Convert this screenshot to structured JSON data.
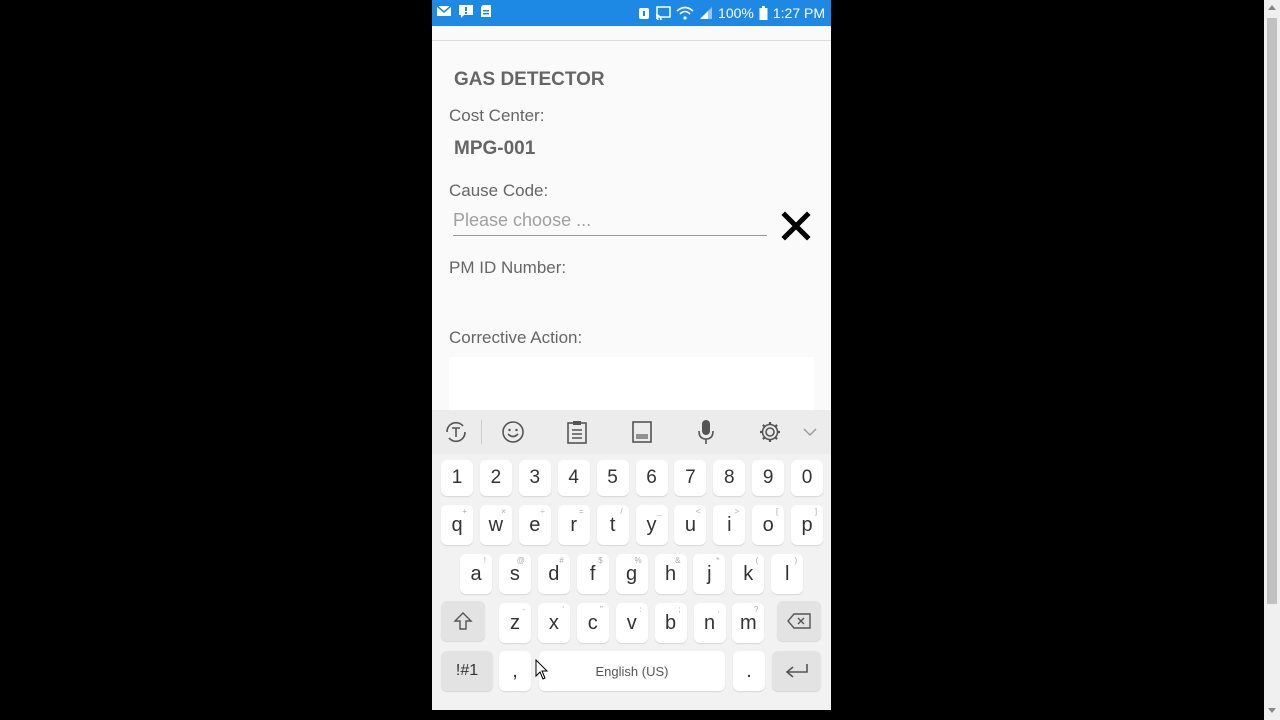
{
  "statusbar": {
    "battery_percent": "100%",
    "time": "1:27 PM"
  },
  "form": {
    "title": "GAS DETECTOR",
    "cost_center_label": "Cost Center:",
    "cost_center_value": "MPG-001",
    "cause_code_label": "Cause Code:",
    "cause_code_placeholder": "Please choose ...",
    "pm_id_label": "PM ID Number:",
    "corrective_action_label": "Corrective Action:"
  },
  "keyboard": {
    "numbers": [
      "1",
      "2",
      "3",
      "4",
      "5",
      "6",
      "7",
      "8",
      "9",
      "0"
    ],
    "row1": [
      "q",
      "w",
      "e",
      "r",
      "t",
      "y",
      "u",
      "i",
      "o",
      "p"
    ],
    "row1_hints": [
      "+",
      "×",
      "÷",
      "=",
      "/",
      "_",
      "<",
      ">",
      "[",
      "]"
    ],
    "row2": [
      "a",
      "s",
      "d",
      "f",
      "g",
      "h",
      "j",
      "k",
      "l"
    ],
    "row2_hints": [
      "!",
      "@",
      "#",
      "$",
      "%",
      "&",
      "*",
      "(",
      ")"
    ],
    "row3": [
      "z",
      "x",
      "c",
      "v",
      "b",
      "n",
      "m"
    ],
    "row3_hints": [
      "-",
      "'",
      "\"",
      ":",
      ";",
      ",",
      "?"
    ],
    "sym_label": "!#1",
    "comma_label": ",",
    "space_label": "English (US)",
    "period_label": "."
  },
  "colors": {
    "statusbar_bg": "#1e88e5",
    "page_bg": "#fafafa",
    "keyboard_bg": "#f2f2f2"
  }
}
